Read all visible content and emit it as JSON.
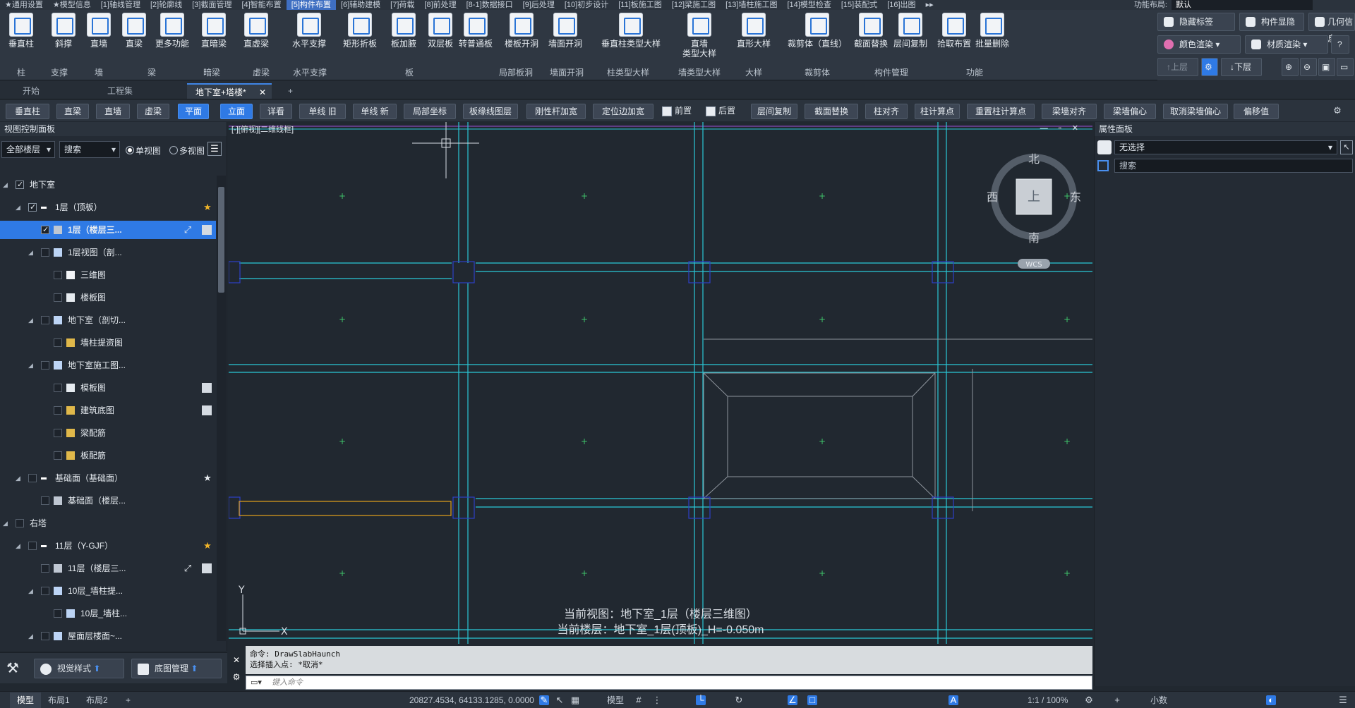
{
  "menu_tabs": [
    "★通用设置",
    "★模型信息",
    "[1]轴线管理",
    "[2]轮廓线",
    "[3]截面管理",
    "[4]智能布置",
    "[5]构件布置",
    "[6]辅助建模",
    "[7]荷载",
    "[8]前处理",
    "[8-1]数据接口",
    "[9]后处理",
    "[10]初步设计",
    "[11]板施工图",
    "[12]梁施工图",
    "[13]墙柱施工图",
    "[14]模型检查",
    "[15]装配式",
    "[16]出图",
    "▸▸"
  ],
  "menu_active_index": 6,
  "menu_right": {
    "label": "功能布局:",
    "value": "默认"
  },
  "ribbon": {
    "buttons": [
      "垂直柱",
      "斜撑",
      "直墙",
      "直梁",
      "更多功能",
      "直暗梁",
      "直虚梁",
      "水平支撑",
      "矩形折板",
      "板加腋",
      "双层板",
      "转普通板",
      "楼板开洞",
      "墙面开洞",
      "垂直柱类型大样",
      "直墙\n类型大样",
      "直形大样",
      "裁剪体（直线）",
      "截面替换",
      "层间复制",
      "拾取布置",
      "批量删除"
    ],
    "groups": [
      "柱",
      "支撑",
      "墙",
      "梁",
      "暗梁",
      "虚梁",
      "水平支撑",
      "板",
      "局部板洞",
      "墙面开洞",
      "柱类型大样",
      "墙类型大样",
      "大样",
      "裁剪体",
      "构件管理",
      "功能"
    ]
  },
  "ribbon_right": {
    "hide_label": "隐藏标签",
    "show_comp": "构件显隐",
    "geo_info": "几何信息",
    "color_render": "颜色渲染",
    "material_render": "材质渲染",
    "up_floor": "上层",
    "down_floor": "下层"
  },
  "doc_tabs": {
    "start": "开始",
    "project": "工程集",
    "current": "地下室+塔楼*",
    "close": "✕",
    "add": "+"
  },
  "toolbar": [
    "垂直柱",
    "直梁",
    "直墙",
    "虚梁",
    "平面",
    "立面",
    "详看",
    "单线 旧",
    "单线 新",
    "局部坐标",
    "板缘线图层",
    "刚性杆加宽",
    "定位边加宽",
    "前置",
    "后置",
    "层间复制",
    "截面替换",
    "柱对齐",
    "柱计算点",
    "重置柱计算点",
    "梁墙对齐",
    "梁墙偏心",
    "取消梁墙偏心",
    "偏移值"
  ],
  "left_panel": {
    "title": "视图控制面板",
    "floor_select": "全部楼层",
    "search": "搜索",
    "single_view": "单视图",
    "multi_view": "多视图",
    "tree": [
      {
        "label": "地下室"
      },
      {
        "label": "1层（顶板）"
      },
      {
        "label": "1层（楼层三..."
      },
      {
        "label": "1层视图（剖..."
      },
      {
        "label": "三维图"
      },
      {
        "label": "楼板图"
      },
      {
        "label": "地下室（剖切..."
      },
      {
        "label": "墙柱提资图"
      },
      {
        "label": "地下室施工图..."
      },
      {
        "label": "模板图"
      },
      {
        "label": "建筑底图"
      },
      {
        "label": "梁配筋"
      },
      {
        "label": "板配筋"
      },
      {
        "label": "基础面（基础面）"
      },
      {
        "label": "基础面（楼层..."
      },
      {
        "label": "右塔"
      },
      {
        "label": "11层（Y-GJF）"
      },
      {
        "label": "11层（楼层三..."
      },
      {
        "label": "10层_墙柱提..."
      },
      {
        "label": "10层_墙柱..."
      },
      {
        "label": "屋面层楼面~..."
      }
    ],
    "bottom": {
      "view_style": "视觉样式",
      "underlay": "底图管理"
    }
  },
  "viewport": {
    "title": "[-][俯视][二维线框]",
    "controls": "— ▫ ✕",
    "compass": {
      "n": "北",
      "s": "南",
      "e": "东",
      "w": "西",
      "center": "上",
      "wcs": "WCS"
    },
    "axis_x": "X",
    "axis_y": "Y",
    "status_line1": "当前视图：地下室_1层（楼层三维图）",
    "status_line2": "当前楼层：地下室_1层(顶板)_H=-0.050m"
  },
  "right_panel": {
    "title": "属性面板",
    "selection": "无选择",
    "search": "搜索"
  },
  "command": {
    "line1": "命令: DrawSlabHaunch",
    "line2": "选择插入点: *取消*",
    "placeholder": "键入命令"
  },
  "status_bar": {
    "tabs": [
      "模型",
      "布局1",
      "布局2",
      "+"
    ],
    "coords": "20827.4534, 64133.1285, 0.0000",
    "model_label": "模型",
    "scale": "1:1 / 100%",
    "units": "小数"
  },
  "colors": {
    "accent": "#2f7ae5",
    "cyan_lines": "#29c7d6",
    "gray_lines": "#8d949c",
    "blue_boxes": "#2d3fc7",
    "orange": "#e3a21b",
    "green_marks": "#3fc26a"
  }
}
